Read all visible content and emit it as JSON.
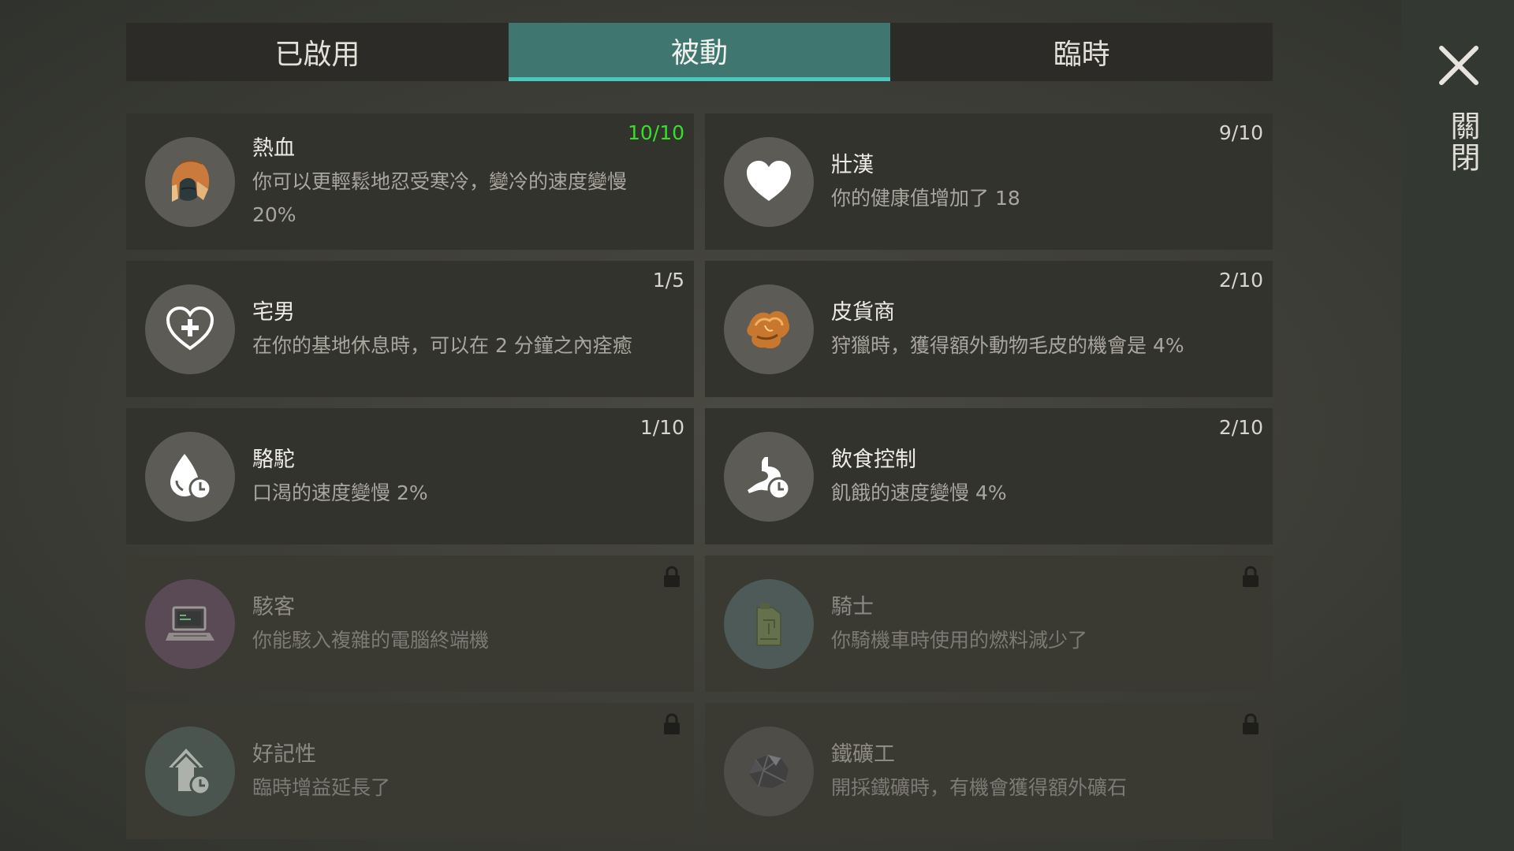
{
  "tabs": [
    {
      "label": "已啟用"
    },
    {
      "label": "被動"
    },
    {
      "label": "臨時"
    }
  ],
  "active_tab": "被動",
  "close_label": "關閉",
  "skills": [
    {
      "name": "熱血",
      "desc": "你可以更輕鬆地忍受寒冷，變冷的速度變慢 20%",
      "level": "10/10",
      "icon": "hat-icon",
      "locked": false
    },
    {
      "name": "壯漢",
      "desc": "你的健康值增加了 18",
      "level": "9/10",
      "icon": "heart-icon",
      "locked": false
    },
    {
      "name": "宅男",
      "desc": "在你的基地休息時，可以在 2 分鐘之內痊癒",
      "level": "1/5",
      "icon": "heart-plus-icon",
      "locked": false
    },
    {
      "name": "皮貨商",
      "desc": "狩獵時，獲得額外動物毛皮的機會是 4%",
      "level": "2/10",
      "icon": "fur-icon",
      "locked": false
    },
    {
      "name": "駱駝",
      "desc": "口渴的速度變慢 2%",
      "level": "1/10",
      "icon": "water-drop-clock-icon",
      "locked": false
    },
    {
      "name": "飲食控制",
      "desc": "飢餓的速度變慢 4%",
      "level": "2/10",
      "icon": "stomach-clock-icon",
      "locked": false
    },
    {
      "name": "駭客",
      "desc": "你能駭入複雜的電腦終端機",
      "level": "",
      "icon": "laptop-icon",
      "locked": true
    },
    {
      "name": "騎士",
      "desc": "你騎機車時使用的燃料減少了",
      "level": "",
      "icon": "fuel-can-icon",
      "locked": true
    },
    {
      "name": "好記性",
      "desc": "臨時增益延長了",
      "level": "",
      "icon": "arrow-up-clock-icon",
      "locked": true
    },
    {
      "name": "鐵礦工",
      "desc": "開採鐵礦時，有機會獲得額外礦石",
      "level": "",
      "icon": "iron-ore-icon",
      "locked": true
    }
  ],
  "colors": {
    "active_tab": "#3f7670",
    "active_tab_underline": "#4cc7bd",
    "max_level": "#36e029"
  }
}
